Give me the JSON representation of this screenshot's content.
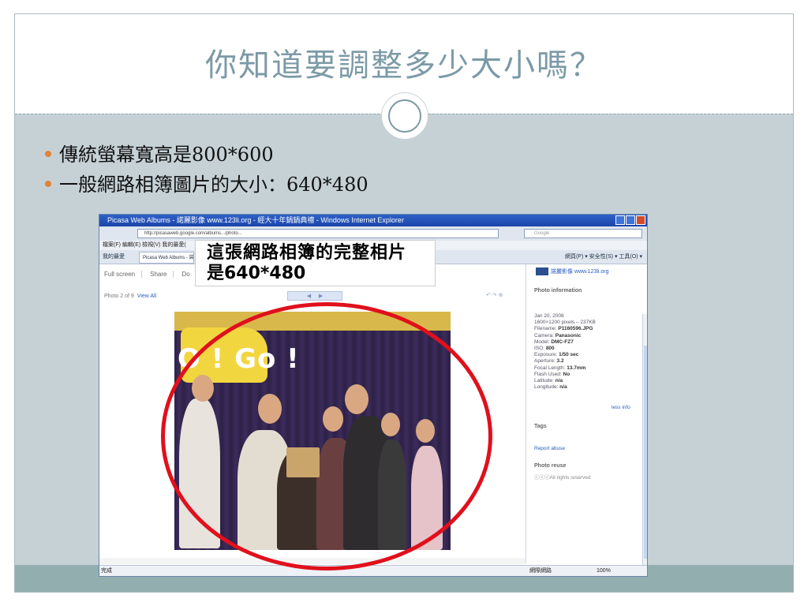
{
  "slide": {
    "title": "你知道要調整多少大小嗎？",
    "bullets": [
      "傳統螢幕寬高是800*600",
      "一般網路相簿圖片的大小：640*480"
    ]
  },
  "browser": {
    "window_title": "Picasa Web Albums - 諾麗影像 www.123li.org - 經大十年鍋鍋典禮 - Windows Internet Explorer",
    "address": "http://picasaweb.google.com/albums.../photo...",
    "search_placeholder": "Google",
    "menu": "檔案(F)   編輯(E)   檢視(V)   我的最愛(",
    "favorites_label": "我的最愛",
    "tab_label": "Picasa Web Albums - 諾",
    "tools_right": "網頁(P) ▾  安全性(S) ▾  工具(O) ▾",
    "toolbar": [
      "Full screen",
      "Share",
      "Do"
    ],
    "photo_count": "Photo 2 of 9",
    "view_all": "View All",
    "photo_text": "O ! Go !",
    "side": {
      "site_name": "諾麗影像 www.123li.org",
      "info_heading": "Photo information",
      "info_lines": [
        [
          "Jan 20, 2008",
          ""
        ],
        [
          "1600×1200 pixels – 237KB",
          ""
        ],
        [
          "Filename: ",
          "P1160596.JPG"
        ],
        [
          "Camera: ",
          "Panasonic"
        ],
        [
          "Model: ",
          "DMC-FZ7"
        ],
        [
          "ISO: ",
          "800"
        ],
        [
          "Exposure: ",
          "1/50 sec"
        ],
        [
          "Aperture: ",
          "3.2"
        ],
        [
          "Focal Length: ",
          "13.7mm"
        ],
        [
          "Flash Used: ",
          "No"
        ],
        [
          "Latitude: ",
          "n/a"
        ],
        [
          "Longitude: ",
          "n/a"
        ]
      ],
      "less_info": "less info",
      "tags_heading": "Tags",
      "report_abuse": "Report abuse",
      "reuse_heading": "Photo reuse",
      "rights": "All rights reserved"
    },
    "status_left": "完成",
    "status_zone": "網際網路",
    "status_zoom": "100%"
  },
  "callout": {
    "line1": "這張網路相簿的完整相片",
    "line2": "是640*480"
  }
}
